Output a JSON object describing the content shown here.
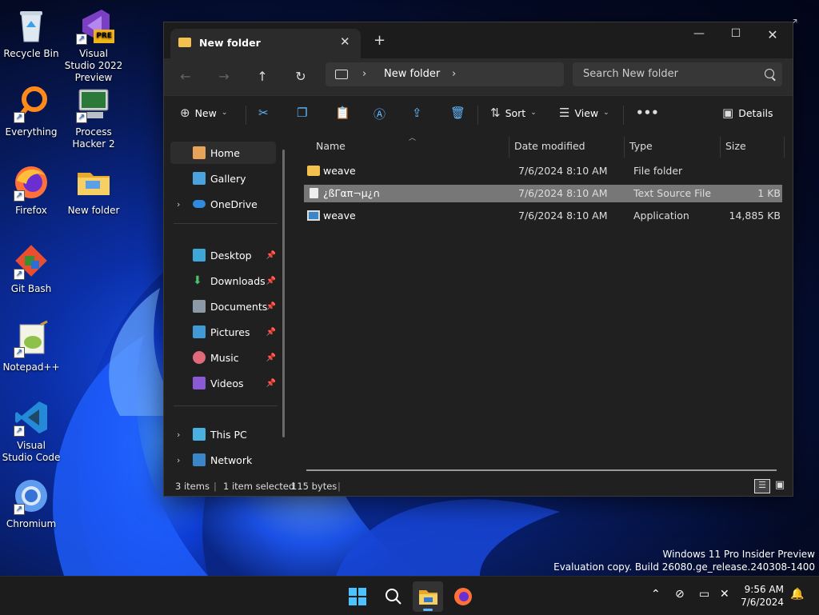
{
  "desktop": {
    "icons": [
      {
        "label": "Recycle Bin",
        "icon": "recycle-bin-icon"
      },
      {
        "label": "Visual Studio 2022 Preview",
        "icon": "visual-studio-icon",
        "badge": "PRE"
      },
      {
        "label": "Everything",
        "icon": "everything-search-icon"
      },
      {
        "label": "Process Hacker 2",
        "icon": "process-hacker-icon"
      },
      {
        "label": "Firefox",
        "icon": "firefox-icon"
      },
      {
        "label": "New folder",
        "icon": "folder-icon"
      },
      {
        "label": "Git Bash",
        "icon": "git-bash-icon"
      },
      {
        "label": "Notepad++",
        "icon": "notepad-plus-plus-icon"
      },
      {
        "label": "Visual Studio Code",
        "icon": "vscode-icon"
      },
      {
        "label": "Chromium",
        "icon": "chromium-icon"
      }
    ],
    "watermark": {
      "line1": "Windows 11 Pro Insider Preview",
      "line2": "Evaluation copy. Build 26080.ge_release.240308-1400"
    }
  },
  "explorer": {
    "tab_title": "New folder",
    "address": {
      "crumb": "New folder"
    },
    "search_placeholder": "Search New folder",
    "commands": {
      "new": "New",
      "sort": "Sort",
      "view": "View",
      "details": "Details"
    },
    "sidebar": {
      "home": "Home",
      "gallery": "Gallery",
      "onedrive": "OneDrive",
      "desktop": "Desktop",
      "downloads": "Downloads",
      "documents": "Documents",
      "pictures": "Pictures",
      "music": "Music",
      "videos": "Videos",
      "thispc": "This PC",
      "network": "Network"
    },
    "columns": {
      "name": "Name",
      "date": "Date modified",
      "type": "Type",
      "size": "Size"
    },
    "files": [
      {
        "name": "weave",
        "date": "7/6/2024 8:10 AM",
        "type": "File folder",
        "size": "",
        "icon": "folder-icon"
      },
      {
        "name": "¿ßΓαπ¬µ¿∩",
        "date": "7/6/2024 8:10 AM",
        "type": "Text Source File",
        "size": "1 KB",
        "icon": "text-file-icon",
        "selected": true
      },
      {
        "name": "weave",
        "date": "7/6/2024 8:10 AM",
        "type": "Application",
        "size": "14,885 KB",
        "icon": "application-icon"
      }
    ],
    "status": {
      "items": "3 items",
      "selection": "1 item selected",
      "bytes": "115 bytes"
    }
  },
  "taskbar": {
    "time": "9:56 AM",
    "date": "7/6/2024"
  },
  "colors": {
    "accent": "#60b8ff",
    "folder": "#f2c14e",
    "window_bg": "#202020"
  }
}
